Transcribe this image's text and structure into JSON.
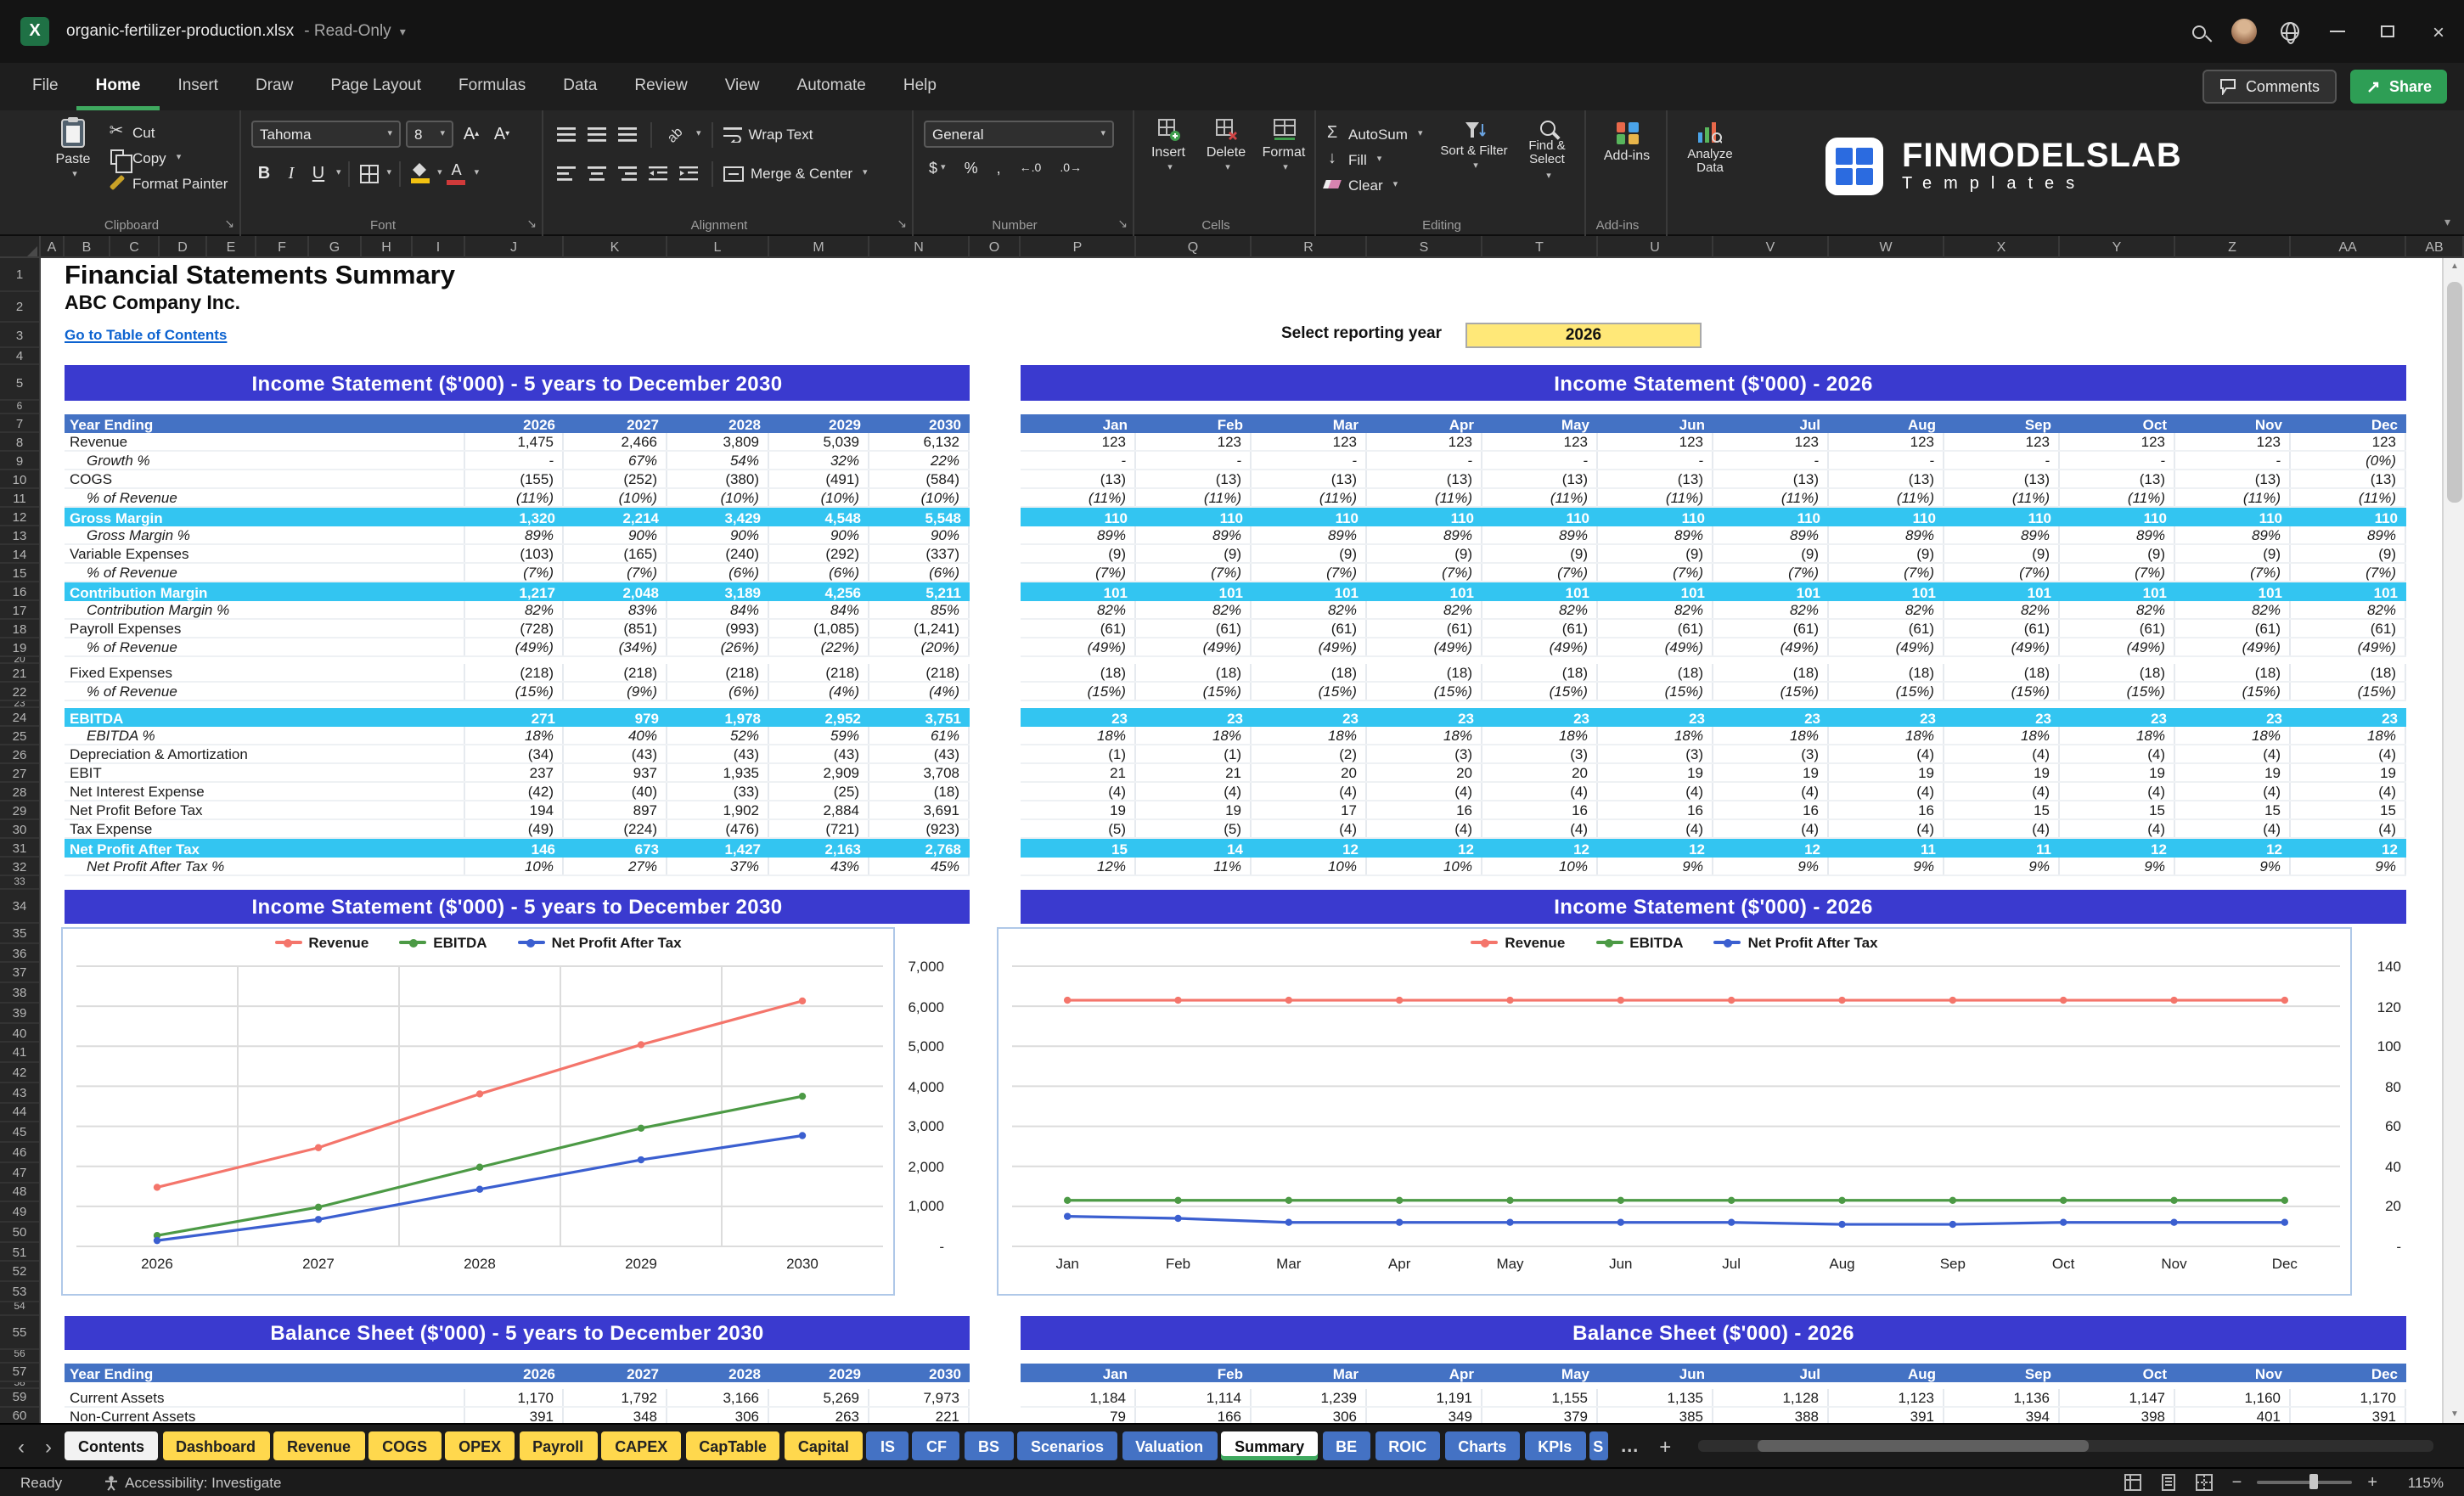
{
  "titlebar": {
    "app_icon_letter": "X",
    "filename": "organic-fertilizer-production.xlsx",
    "dash": "-",
    "mode": "Read-Only"
  },
  "ribbon": {
    "tabs": [
      "File",
      "Home",
      "Insert",
      "Draw",
      "Page Layout",
      "Formulas",
      "Data",
      "Review",
      "View",
      "Automate",
      "Help"
    ],
    "active_tab": "Home",
    "comments": "Comments",
    "share": "Share",
    "glyphs": {
      "bold": "B",
      "italic": "I",
      "underline": "U",
      "currency": "$",
      "percent": "%",
      "comma": ",",
      "increase_decimal": "←.0",
      "decrease_decimal": ".0→",
      "autosum_sigma": "Σ",
      "fill_arrow": "↓",
      "font_color_letter": "A",
      "font_grow": "A",
      "font_shrink": "A",
      "orientation": "ab"
    },
    "groups": {
      "clipboard": {
        "label": "Clipboard",
        "paste": "Paste",
        "cut": "Cut",
        "copy": "Copy",
        "format_painter": "Format Painter"
      },
      "font": {
        "label": "Font",
        "font_name": "Tahoma",
        "font_size": "8"
      },
      "alignment": {
        "label": "Alignment",
        "wrap_text": "Wrap Text",
        "merge_center": "Merge & Center"
      },
      "number": {
        "label": "Number",
        "format": "General"
      },
      "cells": {
        "label": "Cells",
        "insert": "Insert",
        "delete": "Delete",
        "format": "Format"
      },
      "editing": {
        "label": "Editing",
        "autosum": "AutoSum",
        "fill": "Fill",
        "clear": "Clear",
        "sort_filter": "Sort & Filter",
        "find_select": "Find & Select"
      },
      "addins": {
        "label": "Add-ins",
        "button": "Add-ins"
      },
      "analyze": {
        "label": "Analyze Data"
      }
    },
    "logo": {
      "title": "FINMODELSLAB",
      "subtitle": "Templates"
    }
  },
  "grid": {
    "columns": [
      "A",
      "B",
      "C",
      "D",
      "E",
      "F",
      "G",
      "H",
      "I",
      "J",
      "K",
      "L",
      "M",
      "N",
      "O",
      "P",
      "Q",
      "R",
      "S",
      "T",
      "U",
      "V",
      "W",
      "X",
      "Y",
      "Z",
      "AA",
      "AB"
    ],
    "row_start": 1,
    "row_end": 60
  },
  "sheet_header": {
    "title": "Financial Statements Summary",
    "company": "ABC Company Inc.",
    "toc_link": "Go to Table of Contents",
    "select_year_label": "Select reporting year",
    "select_year_value": "2026"
  },
  "statements": {
    "year_ending": "Year Ending",
    "years": [
      "2026",
      "2027",
      "2028",
      "2029",
      "2030"
    ],
    "months": [
      "Jan",
      "Feb",
      "Mar",
      "Apr",
      "May",
      "Jun",
      "Jul",
      "Aug",
      "Sep",
      "Oct",
      "Nov",
      "Dec"
    ],
    "income": {
      "left_title": "Income Statement ($'000) - 5 years to December 2030",
      "right_title": "Income Statement ($'000) - 2026",
      "rows": [
        {
          "label": "Revenue",
          "style": "plain",
          "years": [
            "1,475",
            "2,466",
            "3,809",
            "5,039",
            "6,132"
          ],
          "months": {
            "all": "123"
          }
        },
        {
          "label": "Growth %",
          "style": "pct",
          "years": [
            "-",
            "67%",
            "54%",
            "32%",
            "22%"
          ],
          "months": [
            "-",
            "-",
            "-",
            "-",
            "-",
            "-",
            "-",
            "-",
            "-",
            "-",
            "-",
            "(0%)"
          ]
        },
        {
          "label": "COGS",
          "style": "plain",
          "years": [
            "(155)",
            "(252)",
            "(380)",
            "(491)",
            "(584)"
          ],
          "months": {
            "all": "(13)"
          }
        },
        {
          "label": "% of Revenue",
          "style": "pct",
          "years": [
            "(11%)",
            "(10%)",
            "(10%)",
            "(10%)",
            "(10%)"
          ],
          "months": {
            "all": "(11%)"
          }
        },
        {
          "label": "Gross Margin",
          "style": "band",
          "years": [
            "1,320",
            "2,214",
            "3,429",
            "4,548",
            "5,548"
          ],
          "months": {
            "all": "110"
          }
        },
        {
          "label": "Gross Margin %",
          "style": "pct",
          "years": [
            "89%",
            "90%",
            "90%",
            "90%",
            "90%"
          ],
          "months": {
            "all": "89%"
          }
        },
        {
          "label": "Variable Expenses",
          "style": "plain",
          "years": [
            "(103)",
            "(165)",
            "(240)",
            "(292)",
            "(337)"
          ],
          "months": {
            "all": "(9)"
          }
        },
        {
          "label": "% of Revenue",
          "style": "pct",
          "years": [
            "(7%)",
            "(7%)",
            "(6%)",
            "(6%)",
            "(6%)"
          ],
          "months": {
            "all": "(7%)"
          }
        },
        {
          "label": "Contribution Margin",
          "style": "band",
          "years": [
            "1,217",
            "2,048",
            "3,189",
            "4,256",
            "5,211"
          ],
          "months": {
            "all": "101"
          }
        },
        {
          "label": "Contribution Margin %",
          "style": "pct",
          "years": [
            "82%",
            "83%",
            "84%",
            "84%",
            "85%"
          ],
          "months": {
            "all": "82%"
          }
        },
        {
          "label": "Payroll Expenses",
          "style": "plain",
          "years": [
            "(728)",
            "(851)",
            "(993)",
            "(1,085)",
            "(1,241)"
          ],
          "months": {
            "all": "(61)"
          }
        },
        {
          "label": "% of Revenue",
          "style": "pct",
          "years": [
            "(49%)",
            "(34%)",
            "(26%)",
            "(22%)",
            "(20%)"
          ],
          "months": {
            "all": "(49%)"
          }
        },
        {
          "style": "gap"
        },
        {
          "label": "Fixed Expenses",
          "style": "plain",
          "years": [
            "(218)",
            "(218)",
            "(218)",
            "(218)",
            "(218)"
          ],
          "months": {
            "all": "(18)"
          }
        },
        {
          "label": "% of Revenue",
          "style": "pct",
          "years": [
            "(15%)",
            "(9%)",
            "(6%)",
            "(4%)",
            "(4%)"
          ],
          "months": {
            "all": "(15%)"
          }
        },
        {
          "style": "gap"
        },
        {
          "label": "EBITDA",
          "style": "band",
          "years": [
            "271",
            "979",
            "1,978",
            "2,952",
            "3,751"
          ],
          "months": {
            "all": "23"
          }
        },
        {
          "label": "EBITDA %",
          "style": "pct",
          "years": [
            "18%",
            "40%",
            "52%",
            "59%",
            "61%"
          ],
          "months": {
            "all": "18%"
          }
        },
        {
          "label": "Depreciation & Amortization",
          "style": "plain",
          "years": [
            "(34)",
            "(43)",
            "(43)",
            "(43)",
            "(43)"
          ],
          "months": [
            "(1)",
            "(1)",
            "(2)",
            "(3)",
            "(3)",
            "(3)",
            "(3)",
            "(4)",
            "(4)",
            "(4)",
            "(4)",
            "(4)"
          ]
        },
        {
          "label": "EBIT",
          "style": "plain",
          "years": [
            "237",
            "937",
            "1,935",
            "2,909",
            "3,708"
          ],
          "months": [
            "21",
            "21",
            "20",
            "20",
            "20",
            "19",
            "19",
            "19",
            "19",
            "19",
            "19",
            "19"
          ]
        },
        {
          "label": "Net Interest Expense",
          "style": "plain",
          "years": [
            "(42)",
            "(40)",
            "(33)",
            "(25)",
            "(18)"
          ],
          "months": {
            "all": "(4)"
          }
        },
        {
          "label": "Net Profit Before Tax",
          "style": "plain",
          "years": [
            "194",
            "897",
            "1,902",
            "2,884",
            "3,691"
          ],
          "months": [
            "19",
            "19",
            "17",
            "16",
            "16",
            "16",
            "16",
            "16",
            "15",
            "15",
            "15",
            "15"
          ]
        },
        {
          "label": "Tax Expense",
          "style": "plain",
          "years": [
            "(49)",
            "(224)",
            "(476)",
            "(721)",
            "(923)"
          ],
          "months": [
            "(5)",
            "(5)",
            "(4)",
            "(4)",
            "(4)",
            "(4)",
            "(4)",
            "(4)",
            "(4)",
            "(4)",
            "(4)",
            "(4)"
          ]
        },
        {
          "label": "Net Profit After Tax",
          "style": "band",
          "years": [
            "146",
            "673",
            "1,427",
            "2,163",
            "2,768"
          ],
          "months": [
            "15",
            "14",
            "12",
            "12",
            "12",
            "12",
            "12",
            "11",
            "11",
            "12",
            "12",
            "12"
          ]
        },
        {
          "label": "Net Profit After Tax %",
          "style": "pct",
          "years": [
            "10%",
            "27%",
            "37%",
            "43%",
            "45%"
          ],
          "months": [
            "12%",
            "11%",
            "10%",
            "10%",
            "10%",
            "9%",
            "9%",
            "9%",
            "9%",
            "9%",
            "9%",
            "9%"
          ]
        }
      ]
    },
    "balance": {
      "left_title": "Balance Sheet ($'000) - 5 years to December 2030",
      "right_title": "Balance Sheet ($'000) - 2026",
      "rows": [
        {
          "label": "Current Assets",
          "style": "plain",
          "years": [
            "1,170",
            "1,792",
            "3,166",
            "5,269",
            "7,973"
          ],
          "months": [
            "1,184",
            "1,114",
            "1,239",
            "1,191",
            "1,155",
            "1,135",
            "1,128",
            "1,123",
            "1,136",
            "1,147",
            "1,160",
            "1,170"
          ]
        },
        {
          "label": "Non-Current Assets",
          "style": "plain",
          "years": [
            "391",
            "348",
            "306",
            "263",
            "221"
          ],
          "months": [
            "79",
            "166",
            "306",
            "349",
            "379",
            "385",
            "388",
            "391",
            "394",
            "398",
            "401",
            "391"
          ]
        }
      ]
    }
  },
  "chart_data": [
    {
      "type": "line",
      "title": "Income Statement ($'000) - 5 years to December 2030",
      "x": [
        "2026",
        "2027",
        "2028",
        "2029",
        "2030"
      ],
      "series": [
        {
          "name": "Revenue",
          "color": "#F4756B",
          "values": [
            1475,
            2466,
            3809,
            5039,
            6132
          ]
        },
        {
          "name": "EBITDA",
          "color": "#4C9A45",
          "values": [
            271,
            979,
            1978,
            2952,
            3751
          ]
        },
        {
          "name": "Net Profit After Tax",
          "color": "#3B5FD0",
          "values": [
            146,
            673,
            1427,
            2163,
            2768
          ]
        }
      ],
      "ylim": [
        0,
        7000
      ],
      "ytick": 1000,
      "ytick_labels": [
        "-",
        "1,000",
        "2,000",
        "3,000",
        "4,000",
        "5,000",
        "6,000",
        "7,000"
      ],
      "legend_position": "top",
      "axis_side": "right",
      "vertical_gridlines": true
    },
    {
      "type": "line",
      "title": "Income Statement ($'000) - 2026",
      "x": [
        "Jan",
        "Feb",
        "Mar",
        "Apr",
        "May",
        "Jun",
        "Jul",
        "Aug",
        "Sep",
        "Oct",
        "Nov",
        "Dec"
      ],
      "series": [
        {
          "name": "Revenue",
          "color": "#F4756B",
          "values": [
            123,
            123,
            123,
            123,
            123,
            123,
            123,
            123,
            123,
            123,
            123,
            123
          ]
        },
        {
          "name": "EBITDA",
          "color": "#4C9A45",
          "values": [
            23,
            23,
            23,
            23,
            23,
            23,
            23,
            23,
            23,
            23,
            23,
            23
          ]
        },
        {
          "name": "Net Profit After Tax",
          "color": "#3B5FD0",
          "values": [
            15,
            14,
            12,
            12,
            12,
            12,
            12,
            11,
            11,
            12,
            12,
            12
          ]
        }
      ],
      "ylim": [
        0,
        140
      ],
      "ytick": 20,
      "ytick_labels": [
        "-",
        "20",
        "40",
        "60",
        "80",
        "100",
        "120",
        "140"
      ],
      "legend_position": "top",
      "axis_side": "right",
      "vertical_gridlines": false
    }
  ],
  "sheet_tabs": {
    "tabs": [
      {
        "label": "Contents",
        "color": "light"
      },
      {
        "label": "Dashboard",
        "color": "yellow"
      },
      {
        "label": "Revenue",
        "color": "yellow"
      },
      {
        "label": "COGS",
        "color": "yellow"
      },
      {
        "label": "OPEX",
        "color": "yellow"
      },
      {
        "label": "Payroll",
        "color": "yellow"
      },
      {
        "label": "CAPEX",
        "color": "yellow"
      },
      {
        "label": "CapTable",
        "color": "yellow"
      },
      {
        "label": "Capital",
        "color": "yellow"
      },
      {
        "label": "IS",
        "color": "blue"
      },
      {
        "label": "CF",
        "color": "blue"
      },
      {
        "label": "BS",
        "color": "blue"
      },
      {
        "label": "Scenarios",
        "color": "blue"
      },
      {
        "label": "Valuation",
        "color": "blue"
      },
      {
        "label": "Summary",
        "color": "active"
      },
      {
        "label": "BE",
        "color": "blue"
      },
      {
        "label": "ROIC",
        "color": "blue"
      },
      {
        "label": "Charts",
        "color": "blue"
      },
      {
        "label": "KPIs",
        "color": "blue"
      },
      {
        "label": "S",
        "color": "blue",
        "clipped": true
      }
    ],
    "more": "…",
    "add": "+"
  },
  "statusbar": {
    "ready": "Ready",
    "accessibility": "Accessibility: Investigate",
    "zoom": "115%"
  },
  "colors": {
    "band_title": "#3A3ACF",
    "table_header": "#4472C4",
    "highlight_row": "#33C5F1",
    "select_fill": "#FFE878",
    "tab_yellow": "#FFD84D",
    "tab_blue": "#4472C4",
    "link": "#0D63D0",
    "share_green": "#2E9E55",
    "active_underline": "#3FA95F",
    "chart_border": "#AFC8E8"
  }
}
